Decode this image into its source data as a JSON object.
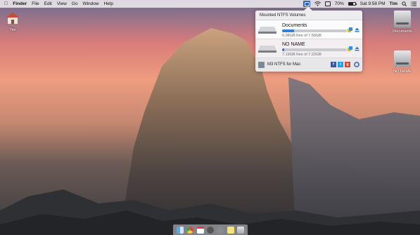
{
  "menubar": {
    "app_name": "Finder",
    "menus": [
      "File",
      "Edit",
      "View",
      "Go",
      "Window",
      "Help"
    ],
    "battery": "70%",
    "clock": "Sat 9:58 PM",
    "user": "Tim"
  },
  "popover": {
    "title": "Mounted NTFS Volumes",
    "volumes": [
      {
        "name": "Documents",
        "free_text": "6.08GB free of 7.55GB",
        "used_fraction": 0.19
      },
      {
        "name": "NO NAME",
        "free_text": "7.19GB free of 7.22GB",
        "used_fraction": 0.004
      }
    ],
    "footer_title": "M3 NTFS for Mac"
  },
  "desktop_icons": {
    "home_label": "Tim",
    "drives": [
      {
        "label": "Documents"
      },
      {
        "label": "NO NAME"
      }
    ]
  },
  "colors": {
    "accent": "#2e7fe6",
    "menubar_icon": "#2a64c6",
    "facebook": "#3b5998",
    "twitter": "#1da1f2",
    "google_plus": "#d34836"
  }
}
